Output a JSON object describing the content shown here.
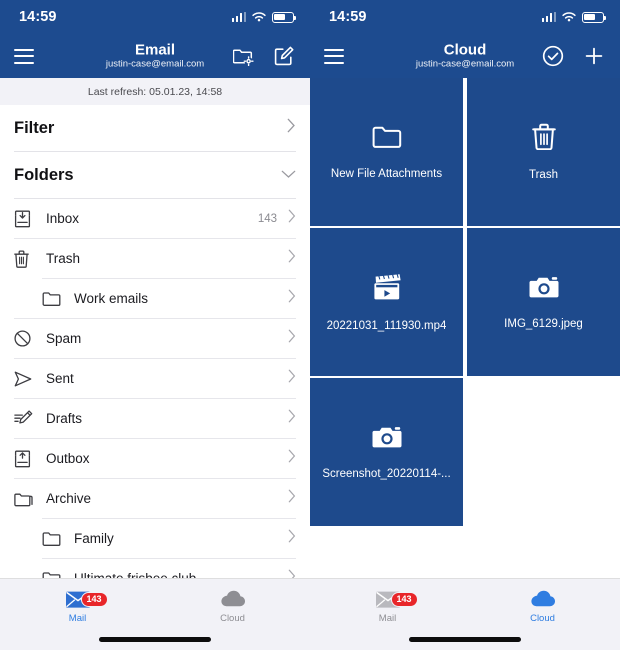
{
  "status_bar": {
    "time": "14:59",
    "signal_icon": "signal-bars-icon",
    "wifi_icon": "wifi-icon",
    "battery_icon": "battery-icon"
  },
  "left_screen": {
    "nav": {
      "menu_icon": "hamburger-menu-icon",
      "title": "Email",
      "subtitle": "justin-case@email.com",
      "folder_settings_icon": "folder-settings-icon",
      "compose_icon": "compose-icon"
    },
    "refresh_text": "Last refresh: 05.01.23, 14:58",
    "filter": {
      "label": "Filter",
      "chevron": "chevron-right-icon"
    },
    "folders_header": {
      "label": "Folders",
      "chevron": "chevron-down-icon"
    },
    "folders": [
      {
        "label": "Inbox",
        "icon": "inbox-tray-icon",
        "count": "143",
        "indent": false
      },
      {
        "label": "Trash",
        "icon": "trash-icon",
        "count": "",
        "indent": false
      },
      {
        "label": "Work emails",
        "icon": "folder-icon",
        "count": "",
        "indent": true
      },
      {
        "label": "Spam",
        "icon": "block-icon",
        "count": "",
        "indent": false
      },
      {
        "label": "Sent",
        "icon": "send-icon",
        "count": "",
        "indent": false
      },
      {
        "label": "Drafts",
        "icon": "draft-pencil-icon",
        "count": "",
        "indent": false
      },
      {
        "label": "Outbox",
        "icon": "outbox-tray-icon",
        "count": "",
        "indent": false
      },
      {
        "label": "Archive",
        "icon": "archive-icon",
        "count": "",
        "indent": false
      },
      {
        "label": "Family",
        "icon": "folder-icon",
        "count": "",
        "indent": true
      },
      {
        "label": "Ultimate frisbee club",
        "icon": "folder-icon",
        "count": "",
        "indent": true
      }
    ],
    "tabs": [
      {
        "label": "Mail",
        "icon": "mail-icon",
        "badge": "143",
        "active": true
      },
      {
        "label": "Cloud",
        "icon": "cloud-icon",
        "badge": "",
        "active": false
      }
    ]
  },
  "right_screen": {
    "nav": {
      "menu_icon": "hamburger-menu-icon",
      "title": "Cloud",
      "subtitle": "justin-case@email.com",
      "select_icon": "check-circle-icon",
      "add_icon": "plus-icon"
    },
    "tiles": [
      {
        "name": "New File Attachments",
        "icon": "folder-icon"
      },
      {
        "name": "Trash",
        "icon": "trash-icon"
      },
      {
        "name": "20221031_111930.mp4",
        "icon": "video-clapperboard-icon"
      },
      {
        "name": "IMG_6129.jpeg",
        "icon": "camera-icon"
      },
      {
        "name": "Screenshot_20220114-...",
        "icon": "camera-icon"
      }
    ],
    "tabs": [
      {
        "label": "Mail",
        "icon": "mail-icon",
        "badge": "143",
        "active": false
      },
      {
        "label": "Cloud",
        "icon": "cloud-icon",
        "badge": "",
        "active": true
      }
    ]
  },
  "colors": {
    "header_blue": "#1d4b8f",
    "tile_blue": "#1e4a8c",
    "accent_blue": "#2f7de1",
    "badge_red": "#e8262a",
    "tabbar_gray": "#f2f2f7"
  }
}
